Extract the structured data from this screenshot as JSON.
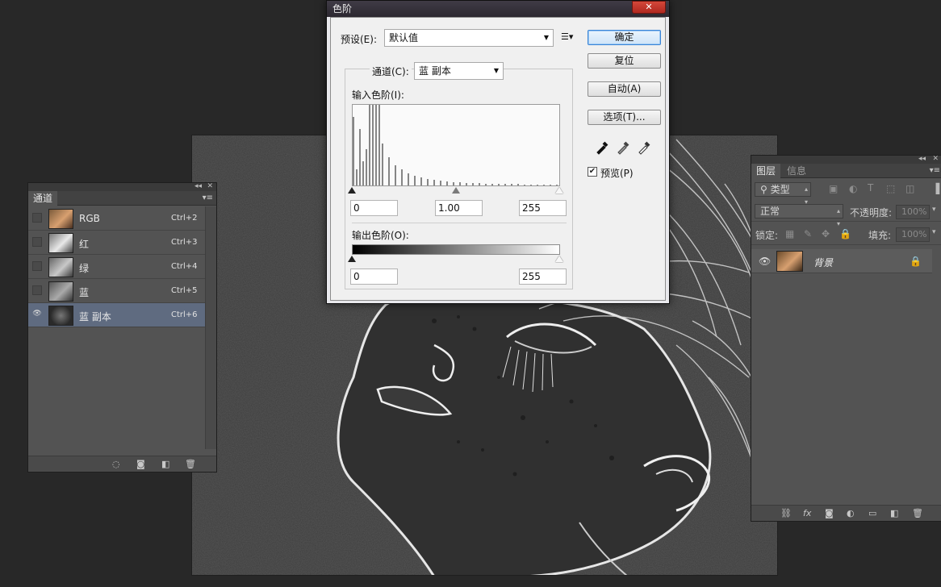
{
  "colors": {
    "accent": "#3a84d6",
    "selected_row": "#5f6b80",
    "panel": "#535353",
    "background": "#282828"
  },
  "levels_dialog": {
    "title": "色阶",
    "close_label": "✕",
    "preset_label": "预设(E):",
    "preset_value": "默认值",
    "preset_menu_icon": "list-menu-icon",
    "channel_label": "通道(C):",
    "channel_value": "蓝 副本",
    "input_levels_label": "输入色阶(I):",
    "input_black": "0",
    "input_gamma": "1.00",
    "input_white": "255",
    "output_levels_label": "输出色阶(O):",
    "output_black": "0",
    "output_white": "255",
    "buttons": {
      "ok": "确定",
      "reset": "复位",
      "auto": "自动(A)",
      "options": "选项(T)..."
    },
    "preview_label": "预览(P)",
    "preview_checked": true
  },
  "channels_panel": {
    "tab": "通道",
    "rows": [
      {
        "name": "RGB",
        "shortcut": "Ctrl+2",
        "visible": false
      },
      {
        "name": "红",
        "shortcut": "Ctrl+3",
        "visible": false
      },
      {
        "name": "绿",
        "shortcut": "Ctrl+4",
        "visible": false
      },
      {
        "name": "蓝",
        "shortcut": "Ctrl+5",
        "visible": false
      },
      {
        "name": "蓝 副本",
        "shortcut": "Ctrl+6",
        "visible": true,
        "selected": true
      }
    ]
  },
  "layers_panel": {
    "tabs": [
      "图层",
      "信息"
    ],
    "filter_label": "类型",
    "blend_mode": "正常",
    "opacity_label": "不透明度:",
    "opacity_value": "100%",
    "lock_label": "锁定:",
    "fill_label": "填充:",
    "fill_value": "100%",
    "layer_name": "背景"
  }
}
